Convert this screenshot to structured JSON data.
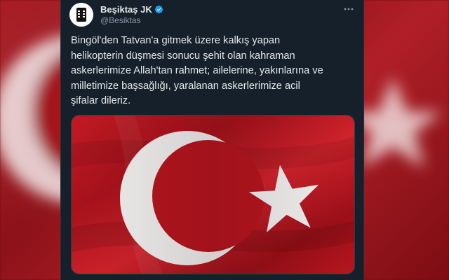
{
  "tweet": {
    "display_name": "Beşiktaş JK",
    "handle": "@Besiktas",
    "verified": true,
    "more_icon": "more-horizontal-icon",
    "text_lines": [
      "Bingöl'den Tatvan'a gitmek üzere kalkış yapan",
      "helikopterin düşmesi sonucu şehit olan kahraman",
      "askerlerimize Allah'tan rahmet; ailelerine, yakınlarına ve",
      "milletimize başsağlığı, yaralanan askerlerimize acil",
      "şifalar dileriz."
    ],
    "media": {
      "kind": "image",
      "subject": "turkish-flag"
    }
  },
  "colors": {
    "card_bg": "#15202b",
    "text": "#e7e9ea",
    "muted": "#8b98a5",
    "verified": "#1d9bf0",
    "flag_red": "#c8102e",
    "flag_white": "#ffffff"
  }
}
